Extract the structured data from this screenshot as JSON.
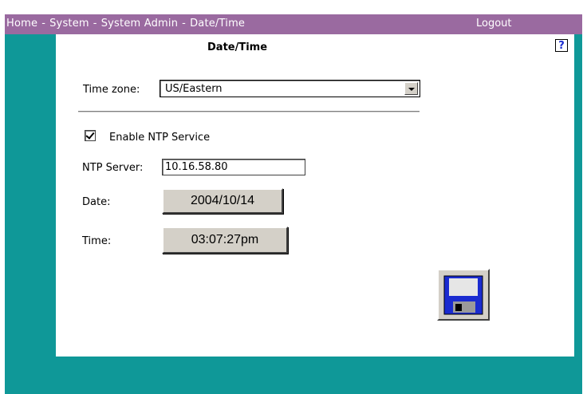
{
  "header": {
    "breadcrumb": [
      "Home",
      "System",
      "System Admin",
      "Date/Time"
    ],
    "separator": "-",
    "logout_label": "Logout"
  },
  "page": {
    "title": "Date/Time",
    "help_label": "?"
  },
  "form": {
    "timezone_label": "Time zone:",
    "timezone_value": "US/Eastern",
    "ntp_enable_label": "Enable NTP Service",
    "ntp_enabled": true,
    "ntp_server_label": "NTP Server:",
    "ntp_server_value": "10.16.58.80",
    "date_label": "Date:",
    "date_value": "2004/10/14",
    "time_label": "Time:",
    "time_value": "03:07:27pm"
  },
  "icons": {
    "save": "floppy-disk-icon",
    "help": "help-icon",
    "dropdown": "chevron-down-icon"
  },
  "colors": {
    "header_bg": "#9a6aa0",
    "frame_bg": "#0f9898",
    "button_bg": "#d4d0c8",
    "help_text": "#1a2bd0"
  }
}
